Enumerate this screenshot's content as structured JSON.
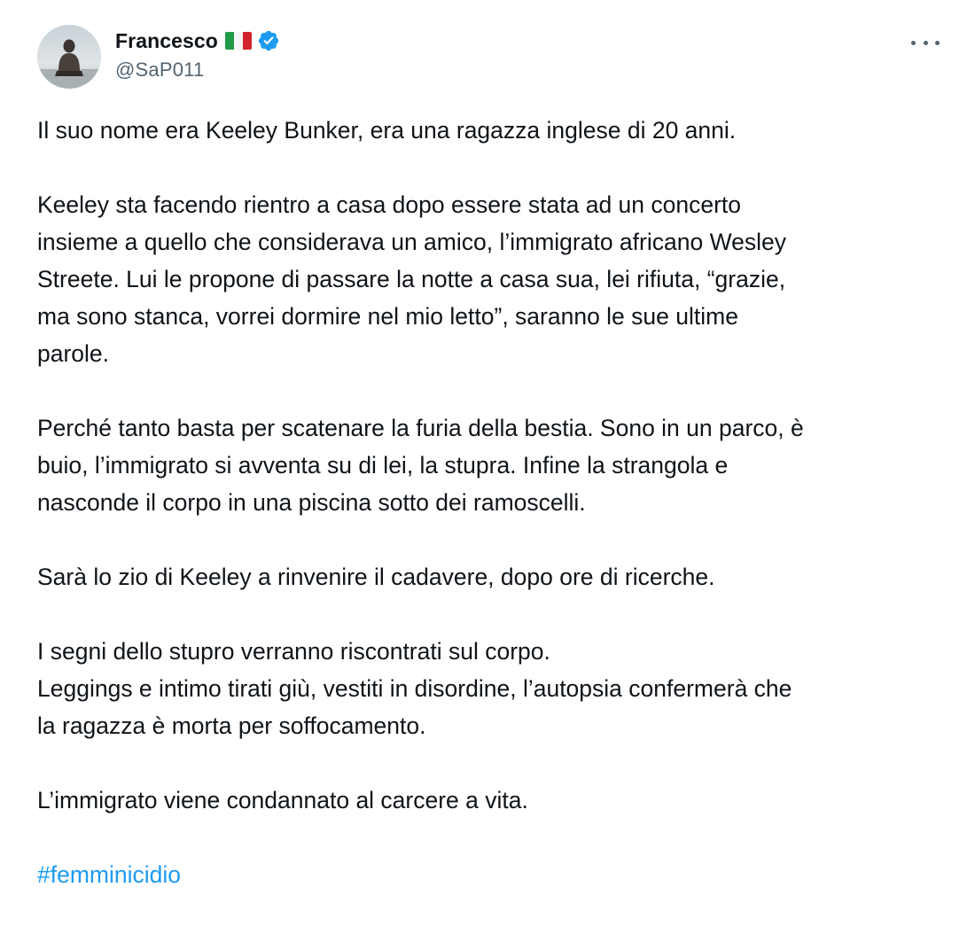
{
  "author": {
    "display_name": "Francesco",
    "handle": "@SaP011",
    "flag_icon": "italy-flag-icon",
    "verified_icon": "verified-badge-icon",
    "verified_color": "#1d9bf0"
  },
  "menu": {
    "icon": "more-options-icon"
  },
  "tweet": {
    "lines": {
      "p1_l1": "Il suo nome era Keeley Bunker, era una ragazza inglese di 20 anni.",
      "p2_l1": "Keeley sta facendo rientro a casa dopo essere stata ad un concerto",
      "p2_l2": "insieme a quello che considerava un amico, l’immigrato africano Wesley",
      "p2_l3": "Streete. Lui le propone di passare la notte a casa sua, lei rifiuta, “grazie,",
      "p2_l4": "ma sono stanca, vorrei dormire nel mio letto”, saranno le sue ultime",
      "p2_l5": "parole.",
      "p3_l1": "Perché tanto basta per scatenare la furia della bestia. Sono in un parco, è",
      "p3_l2": "buio, l’immigrato si avventa su di lei, la stupra. Infine la strangola e",
      "p3_l3": "nasconde il corpo in una piscina sotto dei ramoscelli.",
      "p4_l1": "Sarà lo zio di Keeley a rinvenire il cadavere, dopo ore di ricerche.",
      "p5_l1": "I segni dello stupro verranno riscontrati sul corpo.",
      "p5_l2": "Leggings e intimo tirati giù, vestiti in disordine, l’autopsia confermerà che",
      "p5_l3": "la ragazza è morta per soffocamento.",
      "p6_l1": "L’immigrato viene condannato al carcere a vita."
    },
    "hashtag": "#femminicidio",
    "link_color": "#1d9bf0"
  }
}
